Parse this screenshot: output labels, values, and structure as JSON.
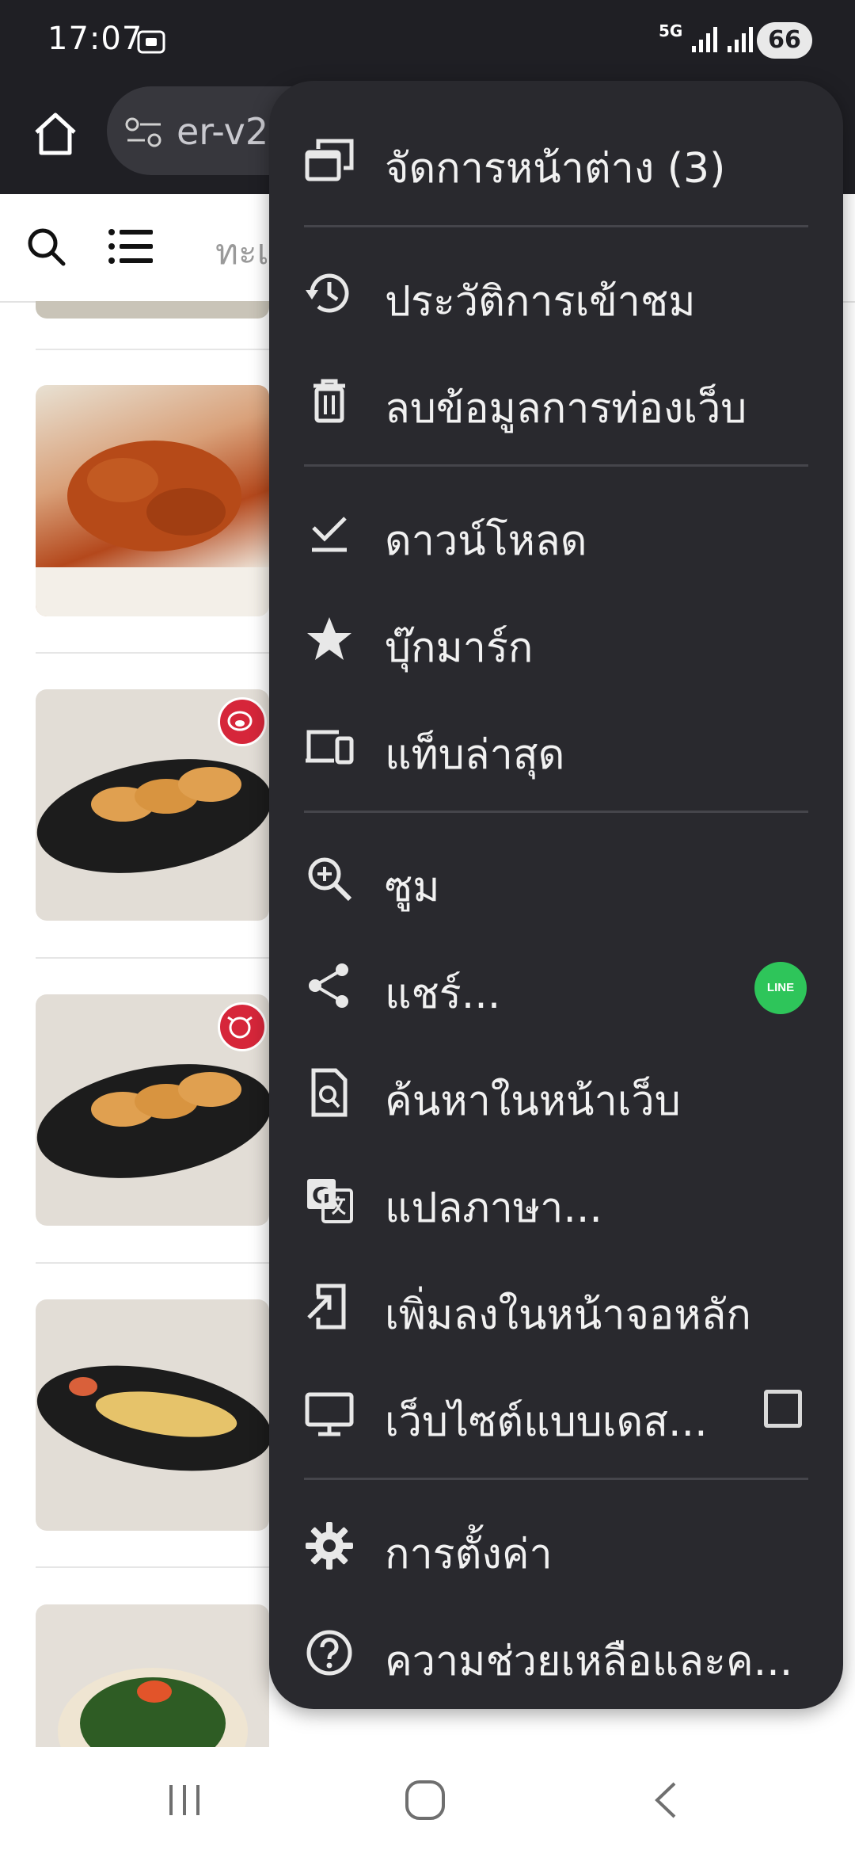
{
  "status_bar": {
    "time": "17:07",
    "network": "5G",
    "battery": "66"
  },
  "browser": {
    "url_fragment": "er-v2",
    "home_icon": "home-icon",
    "site_settings_icon": "tune-icon"
  },
  "page": {
    "tab_fragment": "ทะเล",
    "search_icon": "search-icon",
    "list_icon": "list-icon",
    "items": [
      {
        "name": "fried-chicken-wings",
        "badge": ""
      },
      {
        "name": "gyoza-pork",
        "badge": "pig-icon"
      },
      {
        "name": "gyoza-beef",
        "badge": "cow-icon"
      },
      {
        "name": "shrimp-tempura",
        "badge": ""
      },
      {
        "name": "seaweed-salad",
        "badge": ""
      }
    ]
  },
  "menu": {
    "manage_windows": "จัดการหน้าต่าง (3)",
    "history": "ประวัติการเข้าชม",
    "clear_data": "ลบข้อมูลการท่องเว็บ",
    "downloads": "ดาวน์โหลด",
    "bookmarks": "บุ๊กมาร์ก",
    "recent_tabs": "แท็บล่าสุด",
    "zoom": "ซูม",
    "share": "แชร์...",
    "share_app": "LINE",
    "find_in_page": "ค้นหาในหน้าเว็บ",
    "translate": "แปลภาษา...",
    "add_to_home": "เพิ่มลงในหน้าจอหลัก",
    "desktop_site": "เว็บไซต์แบบเดส...",
    "desktop_site_checked": false,
    "settings": "การตั้งค่า",
    "help": "ความช่วยเหลือและค..."
  },
  "colors": {
    "menu_bg": "#29292e",
    "toolbar_bg": "#1f1f24",
    "line_green": "#2ec55a",
    "badge_red": "#d6263a"
  }
}
